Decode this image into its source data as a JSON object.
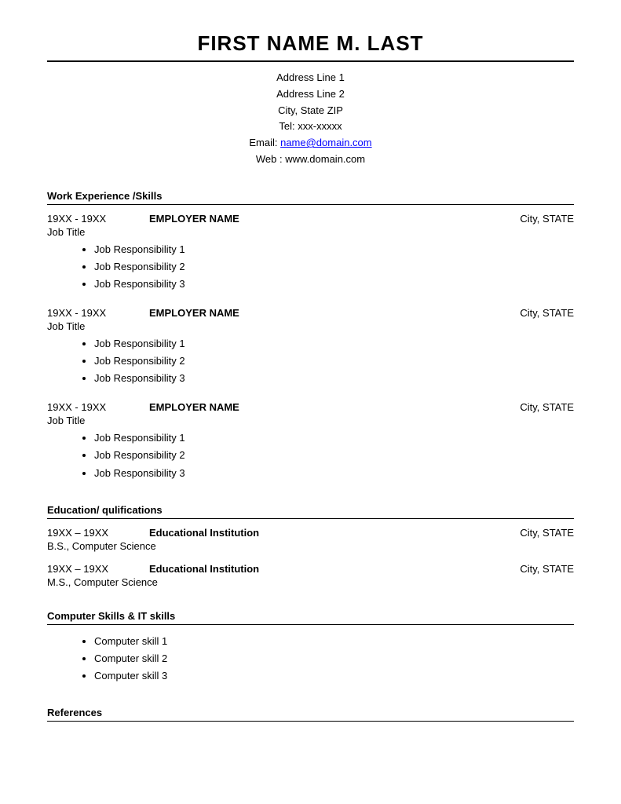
{
  "header": {
    "name": "FIRST NAME M. LAST",
    "address_line1": "Address Line 1",
    "address_line2": "Address Line 2",
    "city_state_zip": "City, State ZIP",
    "tel": "Tel: xxx-xxxxx",
    "email_label": "Email: ",
    "email_address": "name@domain.com",
    "email_href": "mailto:name@domain.com",
    "web": "Web : www.domain.com"
  },
  "sections": {
    "work_experience": {
      "title": "Work Experience /Skills",
      "jobs": [
        {
          "dates": "19XX - 19XX",
          "employer": "EMPLOYER NAME",
          "location": "City, STATE",
          "title": "Job Title",
          "responsibilities": [
            "Job Responsibility 1",
            "Job Responsibility 2",
            "Job Responsibility 3"
          ]
        },
        {
          "dates": "19XX - 19XX",
          "employer": "EMPLOYER NAME",
          "location": "City, STATE",
          "title": "Job Title",
          "responsibilities": [
            "Job Responsibility 1",
            "Job Responsibility 2",
            "Job Responsibility 3"
          ]
        },
        {
          "dates": "19XX - 19XX",
          "employer": "EMPLOYER NAME",
          "location": "City, STATE",
          "title": "Job Title",
          "responsibilities": [
            "Job Responsibility 1",
            "Job Responsibility 2",
            "Job Responsibility 3"
          ]
        }
      ]
    },
    "education": {
      "title": "Education/ qulifications",
      "entries": [
        {
          "dates": "19XX – 19XX",
          "institution": "Educational Institution",
          "location": "City, STATE",
          "degree": "B.S., Computer Science"
        },
        {
          "dates": "19XX – 19XX",
          "institution": "Educational Institution",
          "location": "City, STATE",
          "degree": "M.S., Computer Science"
        }
      ]
    },
    "computer_skills": {
      "title": "Computer Skills & IT skills",
      "skills": [
        "Computer skill 1",
        "Computer skill 2",
        "Computer skill 3"
      ]
    },
    "references": {
      "title": "References"
    }
  }
}
